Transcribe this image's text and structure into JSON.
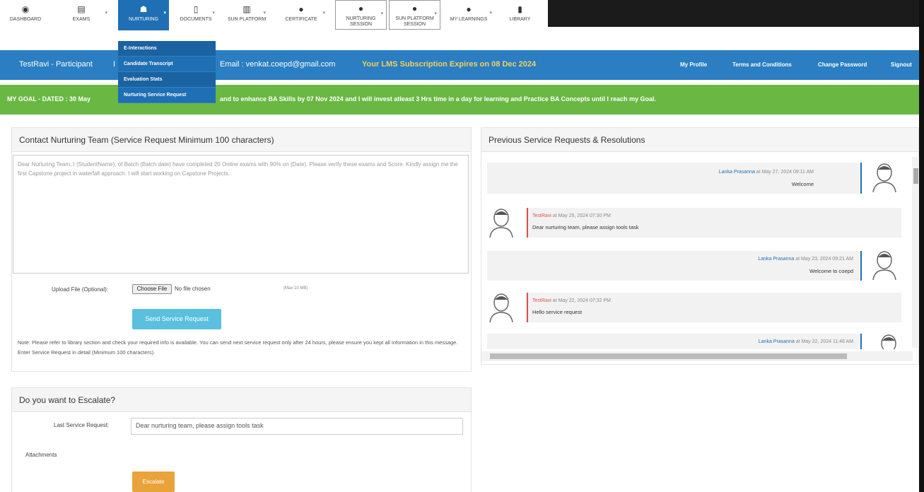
{
  "nav": {
    "items": [
      {
        "label": "DASHBOARD",
        "icon": "dashboard-icon",
        "glyph": "◉"
      },
      {
        "label": "EXAMS",
        "icon": "chart-icon",
        "glyph": "▤"
      },
      {
        "label": "NURTURING",
        "icon": "users-icon",
        "glyph": "☗"
      },
      {
        "label": "DOCUMENTS",
        "icon": "document-icon",
        "glyph": "▯"
      },
      {
        "label": "SUN PLATFORM",
        "icon": "list-icon",
        "glyph": "▥"
      },
      {
        "label": "CERTIFICATE",
        "icon": "dot-icon",
        "glyph": "●"
      },
      {
        "label": "NURTURING SESSION",
        "icon": "dot-icon",
        "glyph": "●"
      },
      {
        "label": "SUN PLATFORM SESSION",
        "icon": "dot-icon",
        "glyph": "●"
      },
      {
        "label": "MY LEARNINGS",
        "icon": "dot-icon",
        "glyph": "●"
      },
      {
        "label": "LIBRARY",
        "icon": "library-icon",
        "glyph": "▮"
      }
    ],
    "dropdown": [
      "E-Interactions",
      "Candidate Transcript",
      "Evaluation Stats",
      "Nurturing Service Request"
    ]
  },
  "header": {
    "user": "TestRavi - Participant",
    "partial": "I",
    "email": "Email : venkat.coepd@gmail.com",
    "subscription": "Your LMS Subscription Expires on 08 Dec 2024",
    "links": [
      "My Profile",
      "Terms and Conditions",
      "Change Password",
      "Signout"
    ]
  },
  "goal": {
    "left": "MY GOAL - DATED : 30 May",
    "right": "and to enhance BA Skills by 07 Nov 2024 and I will invest atleast 3 Hrs time in a day for learning and Practice BA Concepts until I reach my Goal."
  },
  "contact": {
    "title": "Contact Nurturing Team (Service Request Minimum 100 characters)",
    "placeholder": "Dear Nurturing Team, I (StudentName), of Batch (Batch date) have completed 20 Online exams with 90% on (Date). Please verify these exams and Score. Kindly assign me the first Capstone project in waterfall approach. I will start working on Capstone Projects.",
    "upload_label": "Upload File (Optional):",
    "choose_file": "Choose File",
    "no_file": "No file chosen",
    "max_size": "(Max 10 MB)",
    "send_button": "Send Service Request",
    "note": "Note: Please refer to library section and check your required info is available. You can send next service request only after 24 hours, please ensure you kept all information in this message. Enter Service Request in detail (Minimum 100 characters)."
  },
  "escalate": {
    "title": "Do you want to Escalate?",
    "last_label": "Last Service Request:",
    "last_value": "Dear nurturing team, please assign tools task",
    "attachments_label": "Attachments",
    "button": "Escalate"
  },
  "history": {
    "title": "Previous Service Requests & Resolutions",
    "messages": [
      {
        "side": "right",
        "who": "Lanka Prasanna",
        "when": "at May 27, 2024 09:11 AM",
        "text": "Welcome"
      },
      {
        "side": "left",
        "who": "TestRavi",
        "when": "at May 25, 2024 07:30 PM",
        "text": "Dear nurturing team, please assign tools task"
      },
      {
        "side": "right",
        "who": "Lanka Prasanna",
        "when": "at May 23, 2024 09:21 AM",
        "text": "Welcome to coepd"
      },
      {
        "side": "left",
        "who": "TestRavi",
        "when": "at May 22, 2024 07:32 PM",
        "text": "Hello service request"
      },
      {
        "side": "right",
        "who": "Lanka Prasanna",
        "when": "at May 22, 2024 11:48 AM",
        "text": ""
      }
    ]
  },
  "colors": {
    "nav_active": "#1f6fb4",
    "header_blue": "#2a7ec1",
    "goal_green": "#6ab744",
    "send_button": "#5bc0de",
    "escalate_button": "#e8a33a",
    "subscription_text": "#f0d060"
  }
}
